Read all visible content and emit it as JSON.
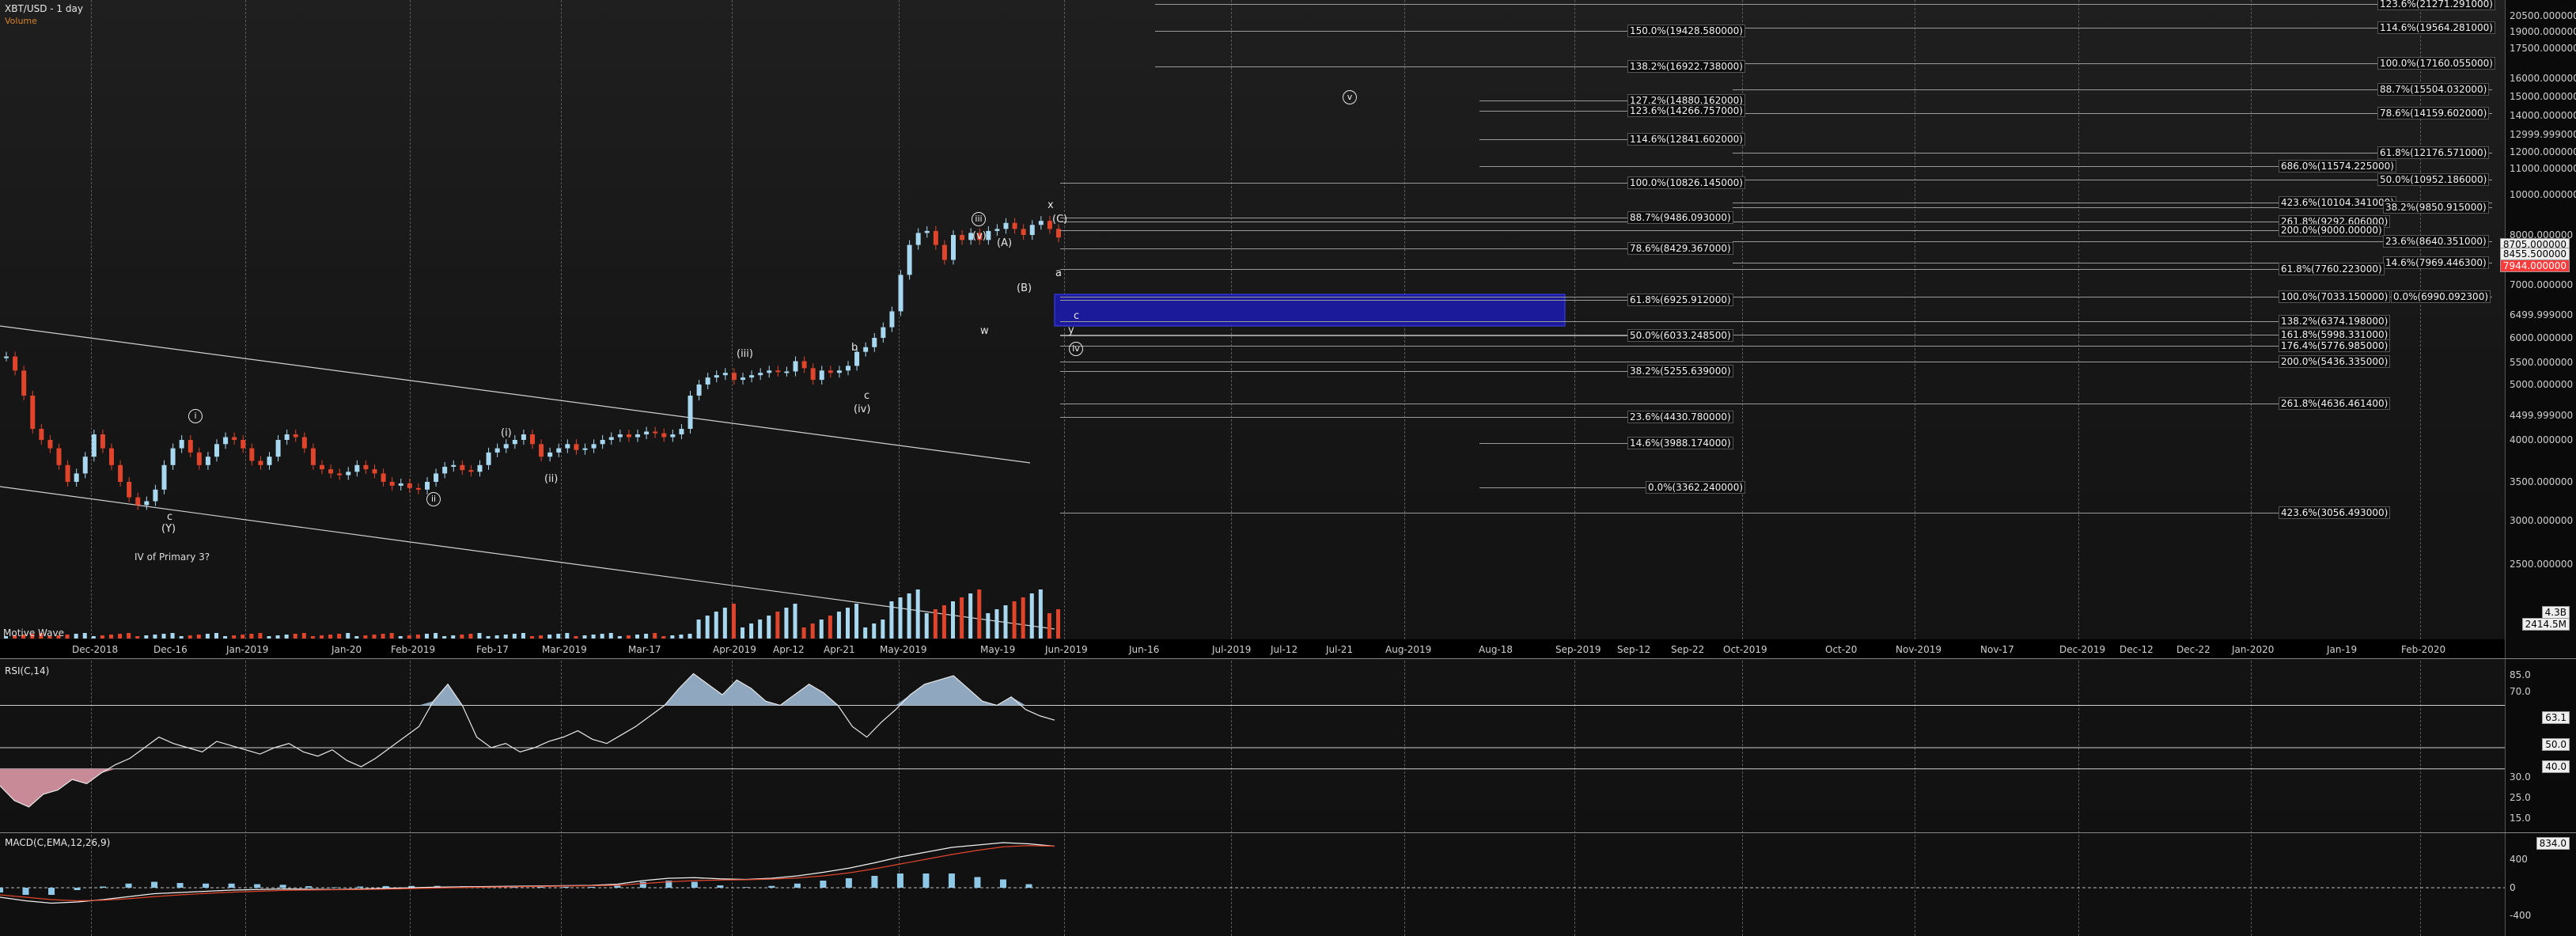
{
  "header": {
    "title": "XBT/USD - 1 day",
    "volume_label": "Volume"
  },
  "rsi": {
    "title": "RSI(C,14)",
    "ticks": [
      "85.0",
      "70.0",
      "63.1",
      "50.0",
      "40.0",
      "25.0",
      "15.0",
      "30.0"
    ],
    "current": "63.1",
    "levels": [
      "50.0",
      "40.0"
    ]
  },
  "macd": {
    "title": "MACD(C,EMA,12,26,9)",
    "ticks": [
      "400",
      "0",
      "-400"
    ],
    "current": "834.0"
  },
  "volume": {
    "ticks": [
      "4.3B",
      "2414.5M"
    ]
  },
  "x_ticks": [
    "Dec-2018",
    "Dec-16",
    "Jan-2019",
    "Jan-20",
    "Feb-2019",
    "Feb-17",
    "Mar-2019",
    "Mar-17",
    "Apr-2019",
    "Apr-12",
    "Apr-21",
    "May-2019",
    "May-19",
    "Jun-2019",
    "Jun-16",
    "Jul-2019",
    "Jul-12",
    "Jul-21",
    "Aug-2019",
    "Aug-18",
    "Sep-2019",
    "Sep-12",
    "Sep-22",
    "Oct-2019",
    "Oct-20",
    "Nov-2019",
    "Nov-17",
    "Dec-2019",
    "Dec-12",
    "Dec-22",
    "Jan-2020",
    "Jan-19",
    "Feb-2020"
  ],
  "price_ticks": [
    "20500.000000",
    "19000.000000",
    "17500.000000",
    "16000.000000",
    "15000.000000",
    "14000.000000",
    "12999.999000",
    "12000.000000",
    "11000.000000",
    "10000.000000",
    "8000.000000",
    "7000.000000",
    "6499.999000",
    "6000.000000",
    "5500.000000",
    "5000.000000",
    "4499.999000",
    "4000.000000",
    "3500.000000",
    "3000.000000",
    "2500.000000"
  ],
  "price_boxes": {
    "a": "8705.000000",
    "b": "8455.500000",
    "current": "7944.000000"
  },
  "fib_labels": [
    "150.0%(19428.580000)",
    "114.6%(19564.281000)",
    "138.2%(16922.738000)",
    "100.0%(17160.055000)",
    "88.7%(15504.032000)",
    "127.2%(14880.162000)",
    "123.6%(14266.757000)",
    "78.6%(14159.602000)",
    "114.6%(12841.602000)",
    "61.8%(12176.571000)",
    "686.0%(11574.225000)",
    "100.0%(10826.145000)",
    "50.0%(10952.186000)",
    "423.6%(10104.341000)",
    "38.2%(9850.915000)",
    "88.7%(9486.093000)",
    "261.8%(9292.606000)",
    "200.0%(9000.00000)",
    "23.6%(8640.351000)",
    "78.6%(8429.367000)",
    "14.6%(7969.446300)",
    "61.8%(7760.223000)",
    "100.0%(7033.150000)",
    "0.0%(6990.092300)",
    "61.8%(6925.912000)",
    "138.2%(6374.198000)",
    "161.8%(5998.331000)",
    "50.0%(6033.248500)",
    "176.4%(5776.985000)",
    "200.0%(5436.335000)",
    "38.2%(5255.639000)",
    "261.8%(4636.461400)",
    "23.6%(4430.780000)",
    "14.6%(3988.174000)",
    "0.0%(3362.240000)",
    "423.6%(3056.493000)",
    "123.6%(21271.291000)"
  ],
  "waves": {
    "i": "i",
    "ii": "ii",
    "iii": "iii",
    "iv": "iv",
    "v": "v",
    "w": "w",
    "x": "x",
    "y": "y",
    "c_small": "c",
    "Y": "(Y)",
    "i_paren": "(i)",
    "ii_paren": "(ii)",
    "iii_paren": "(iii)",
    "iv_paren": "(iv)",
    "v_paren": "(v)",
    "A": "(A)",
    "B": "(B)",
    "C": "(C)",
    "a": "a",
    "b": "b",
    "c": "c"
  },
  "notes": {
    "primary": "IV of Primary 3?",
    "motive": "Motive Wave"
  },
  "colors": {
    "up": "#a8d8f0",
    "down": "#e0452c",
    "zone": "#1a1a9a",
    "rsi_fill": "#8fa7bf",
    "rsi_fill_low": "#c98a98"
  }
}
